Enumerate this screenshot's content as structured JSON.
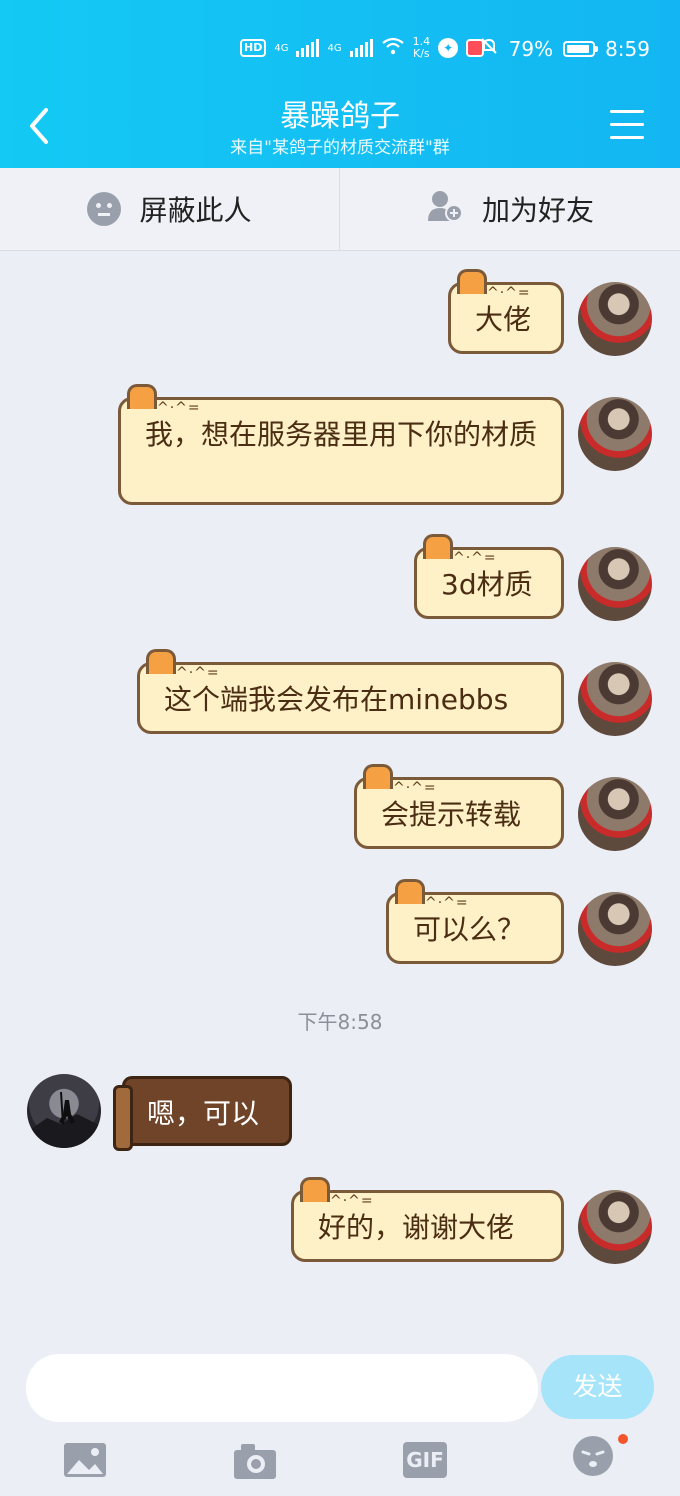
{
  "status_bar": {
    "hd": "HD",
    "signal1": "4G",
    "signal2": "4G",
    "net_speed_value": "1.4",
    "net_speed_unit": "K/s",
    "battery": "79%",
    "time": "8:59"
  },
  "header": {
    "title": "暴躁鸽子",
    "subtitle": "来自\"某鸽子的材质交流群\"群"
  },
  "actions": {
    "block_label": "屏蔽此人",
    "add_friend_label": "加为好友"
  },
  "messages": [
    {
      "from": "me",
      "text": "大佬"
    },
    {
      "from": "me",
      "text": "我，想在服务器里用下你的材质"
    },
    {
      "from": "me",
      "text": "3d材质"
    },
    {
      "from": "me",
      "text": "这个端我会发布在minebbs"
    },
    {
      "from": "me",
      "text": "会提示转载"
    },
    {
      "from": "me",
      "text": "可以么？"
    },
    {
      "from": "other",
      "text": "嗯，可以"
    },
    {
      "from": "me",
      "text": "好的，谢谢大佬"
    }
  ],
  "time_separator": "下午8:58",
  "composer": {
    "send_label": "发送",
    "gif_label": "GIF"
  },
  "cat_face": "^·^="
}
